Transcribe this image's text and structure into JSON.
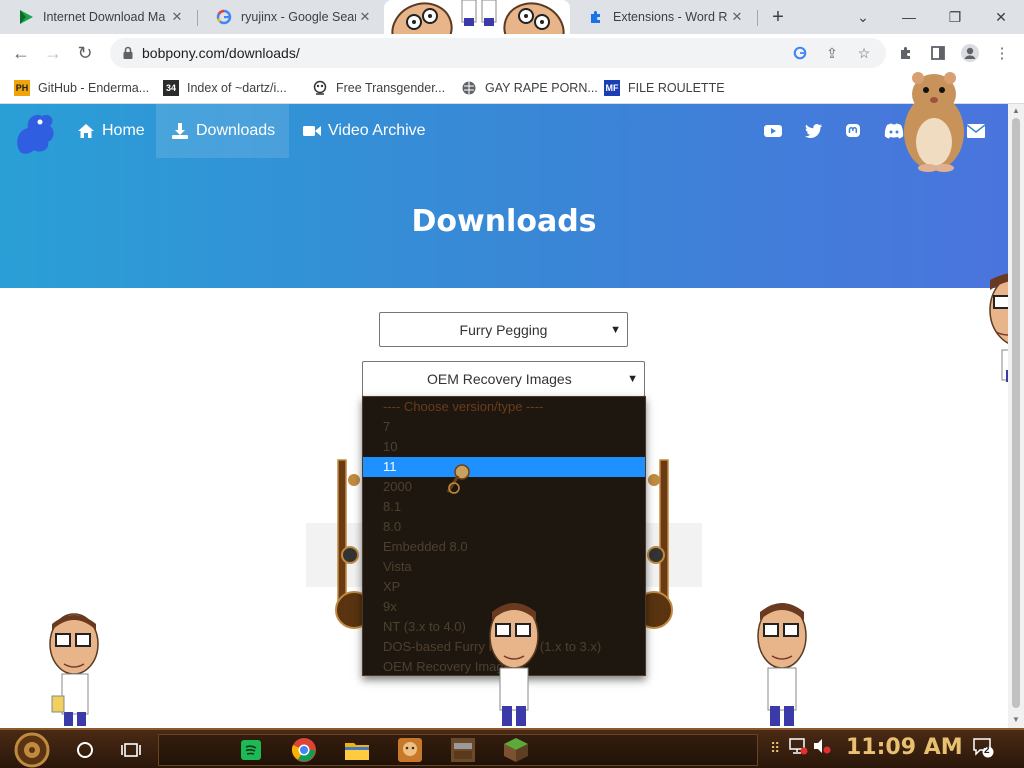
{
  "browser": {
    "tabs": [
      {
        "title": "Internet Download Ma",
        "favicon": "idm-play-icon"
      },
      {
        "title": "ryujinx - Google Search",
        "favicon": "google-g-icon"
      },
      {
        "title": "",
        "favicon": "faces-overlay"
      },
      {
        "title": "Extensions - Word Re",
        "favicon": "puzzle-icon"
      }
    ],
    "new_tab_label": "+",
    "url": "bobpony.com/downloads/",
    "bookmarks": [
      {
        "label": "GitHub - Enderma...",
        "icon": "PH",
        "color": "#f0a30a"
      },
      {
        "label": "Index of ~dartz/i...",
        "icon": "34",
        "color": "#2b2b2b"
      },
      {
        "label": "Free Transgender...",
        "icon": "mascot-icon",
        "color": "#555555"
      },
      {
        "label": "GAY RAPE PORN...",
        "icon": "globe-icon",
        "color": "#5f6368"
      },
      {
        "label": "FILE ROULETTE",
        "icon": "MF",
        "color": "#1a3fb5"
      }
    ]
  },
  "site": {
    "nav": [
      {
        "label": "Home",
        "icon": "home-icon"
      },
      {
        "label": "Downloads",
        "icon": "download-icon"
      },
      {
        "label": "Video Archive",
        "icon": "video-icon"
      }
    ],
    "social_icons": [
      "youtube-icon",
      "twitter-icon",
      "mastodon-icon",
      "discord-icon",
      "hamster-overlay",
      "mail-icon"
    ],
    "hero_title": "Downloads",
    "os_select_value": "Furry Pegging",
    "type_select_value": "OEM Recovery Images",
    "dropdown_options": [
      "---- Choose version/type ----",
      "7",
      "10",
      "11",
      "2000",
      "8.1",
      "8.0",
      "Embedded 8.0",
      "Vista",
      "XP",
      "9x",
      "NT (3.x to 4.0)",
      "DOS-based Furry Pegging (1.x to 3.x)",
      "OEM Recovery Images"
    ],
    "dropdown_selected_index": 3
  },
  "taskbar": {
    "clock": "11:09 AM",
    "notification_count": "2",
    "apps": [
      "spotify-icon",
      "chrome-icon",
      "file-explorer-icon",
      "game-icon",
      "minecraft-icon",
      "minecraft-grass-icon"
    ]
  },
  "colors": {
    "hero_start": "#2a9fd6",
    "hero_end": "#4a74dd",
    "dropdown_bg": "#1e1710",
    "dropdown_highlight": "#1e90ff",
    "taskbar_bg": "#2a170a"
  }
}
